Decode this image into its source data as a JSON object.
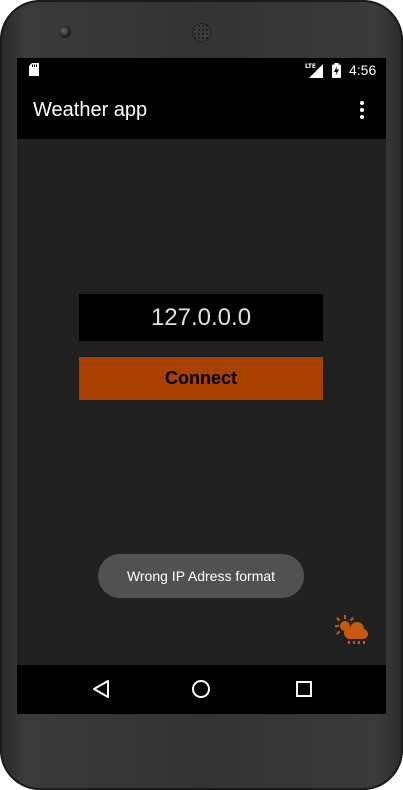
{
  "status_bar": {
    "time": "4:56",
    "network": "LTE",
    "icons": [
      "sd-card-icon",
      "lte-signal-icon",
      "battery-charging-icon"
    ]
  },
  "app_bar": {
    "title": "Weather app",
    "menu_icon": "overflow-menu-icon"
  },
  "main": {
    "ip_input_value": "127.0.0.0",
    "connect_label": "Connect",
    "toast_text": "Wrong IP Adress format",
    "fab_icon": "weather-cloud-sun-rain-icon"
  },
  "nav_bar": {
    "icons": [
      "back-icon",
      "home-icon",
      "recent-apps-icon"
    ]
  },
  "colors": {
    "accent": "#a74000",
    "icon_accent": "#c85a10",
    "background": "#212121",
    "bar": "#000000",
    "toast": "#515151"
  }
}
